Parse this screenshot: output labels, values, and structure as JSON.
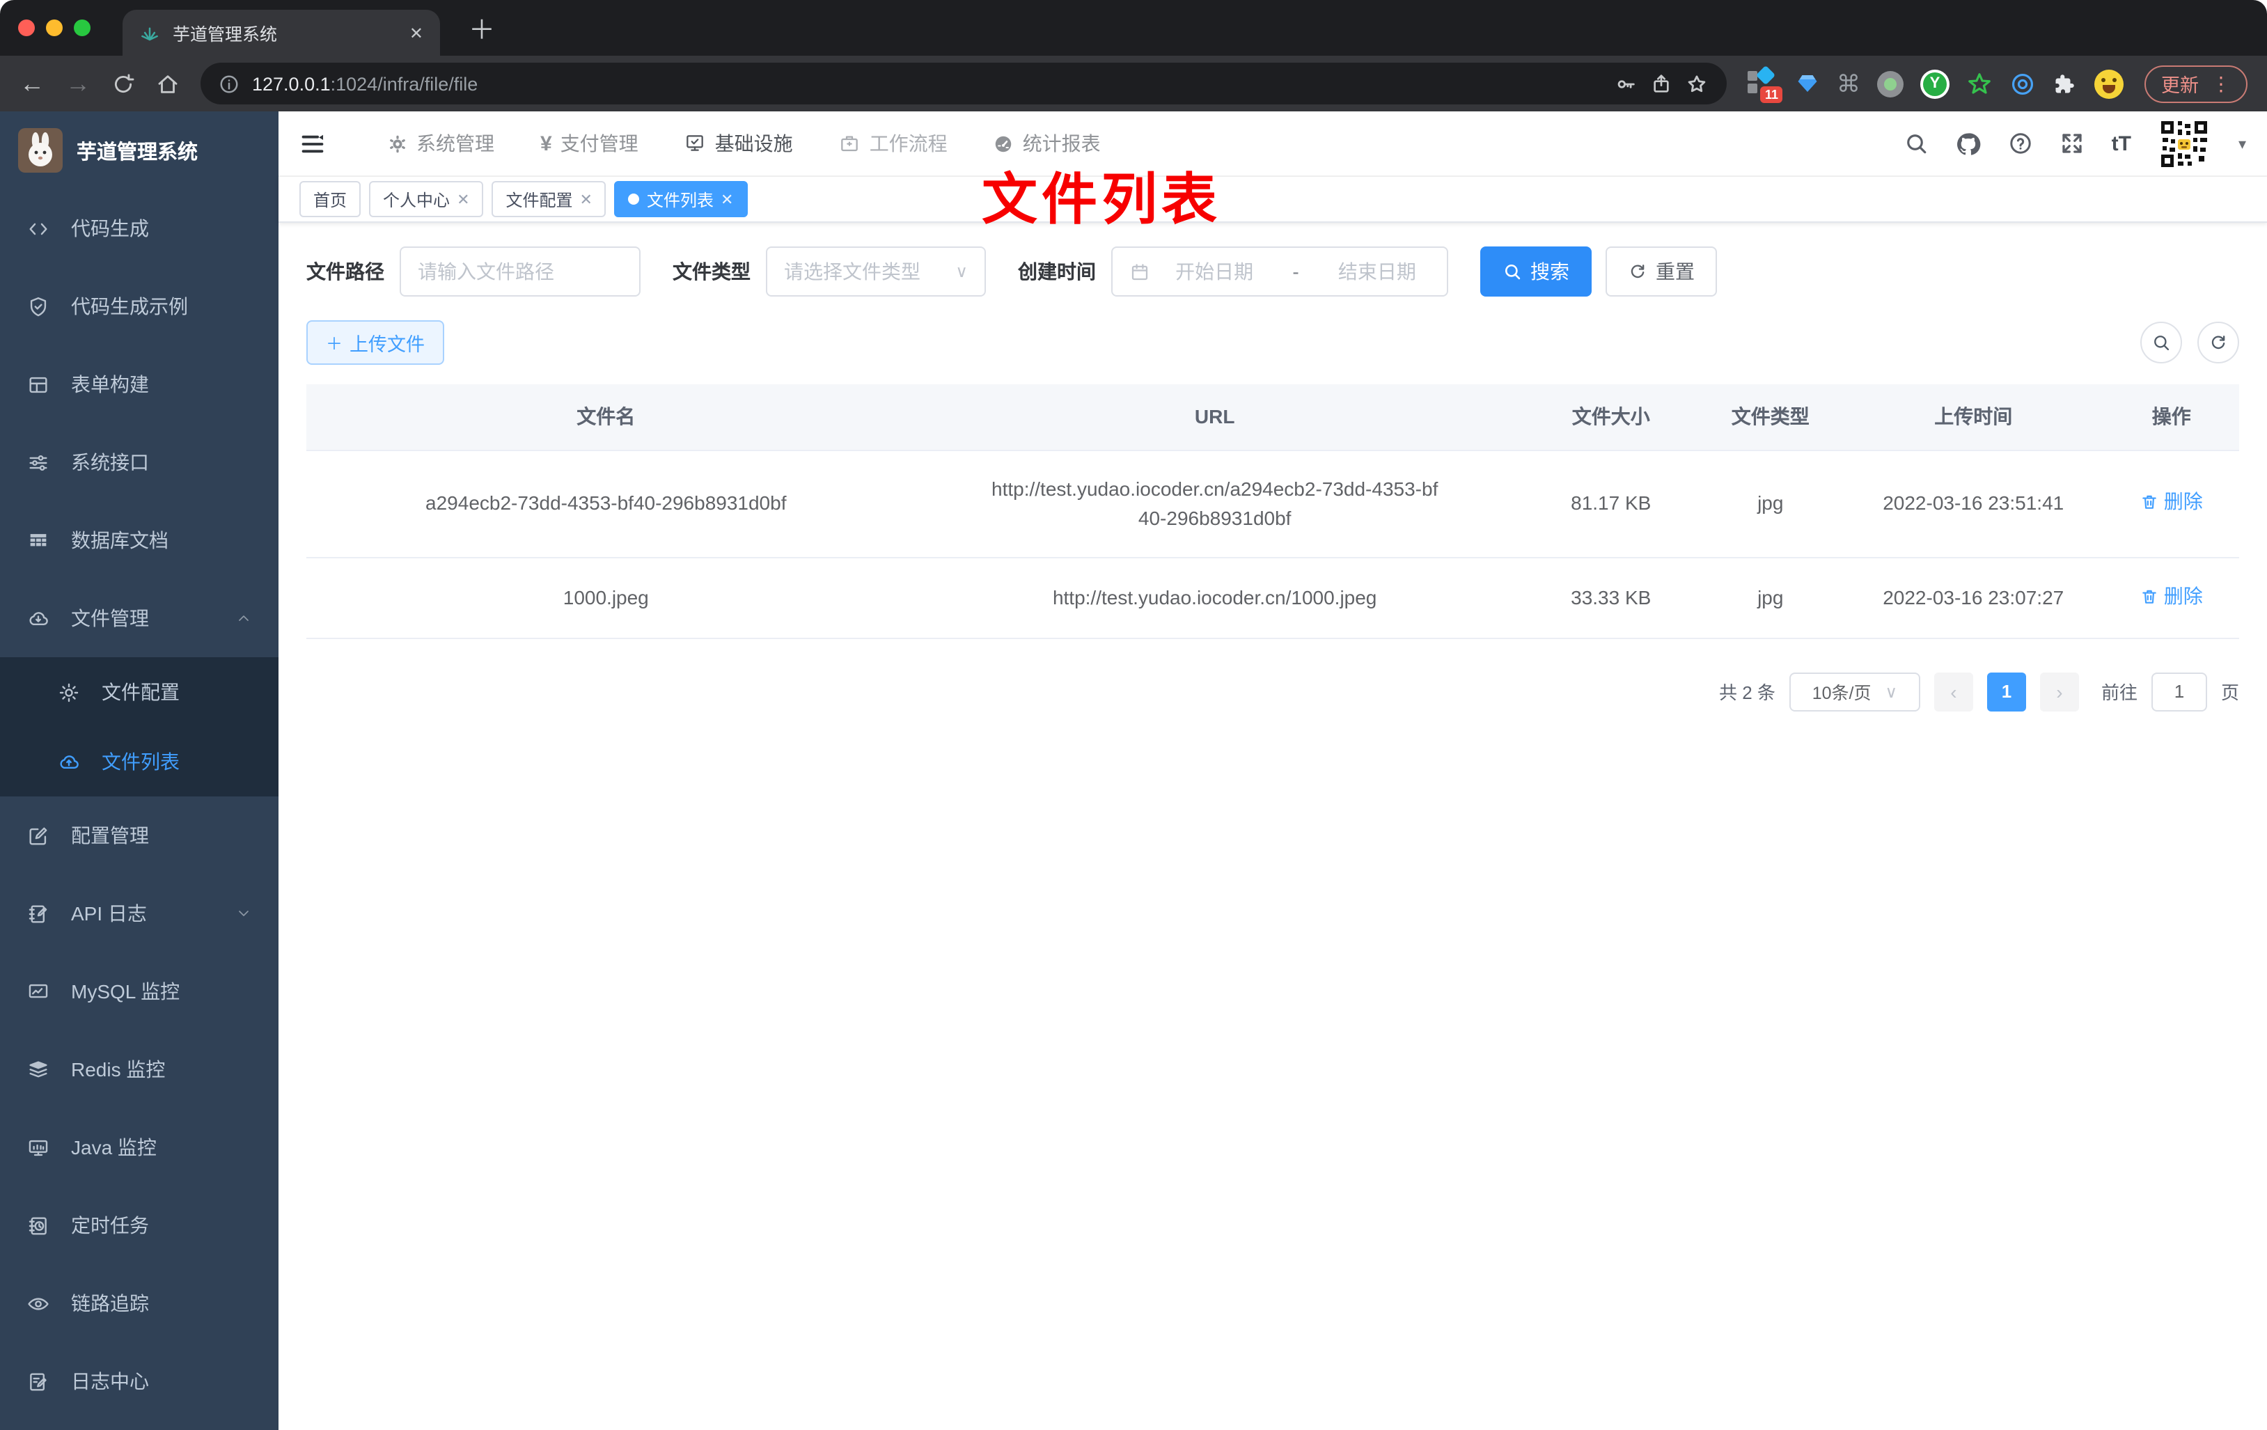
{
  "browser": {
    "tab_title": "芋道管理系统",
    "address": {
      "host": "127.0.0.1",
      "rest": ":1024/infra/file/file"
    },
    "extensions": {
      "badge_count": "11",
      "y_letter": "Y"
    },
    "update_button": "更新"
  },
  "glyphs": {
    "close": "✕",
    "plus": "＋",
    "back": "←",
    "forward": "→",
    "dots": "⋮",
    "command": "⌘",
    "caret_down": "▾",
    "yen": "¥",
    "dash": "-",
    "chevron_down": "∨",
    "prev": "‹",
    "next": "›",
    "font_size": "tT",
    "plus_small": "＋"
  },
  "sidebar": {
    "title": "芋道管理系统",
    "items": [
      {
        "label": "代码生成"
      },
      {
        "label": "代码生成示例"
      },
      {
        "label": "表单构建"
      },
      {
        "label": "系统接口"
      },
      {
        "label": "数据库文档"
      },
      {
        "label": "文件管理"
      },
      {
        "label": "文件配置"
      },
      {
        "label": "文件列表"
      },
      {
        "label": "配置管理"
      },
      {
        "label": "API 日志"
      },
      {
        "label": "MySQL 监控"
      },
      {
        "label": "Redis 监控"
      },
      {
        "label": "Java 监控"
      },
      {
        "label": "定时任务"
      },
      {
        "label": "链路追踪"
      },
      {
        "label": "日志中心"
      }
    ]
  },
  "topnav": {
    "items": [
      {
        "label": "系统管理"
      },
      {
        "label": "支付管理"
      },
      {
        "label": "基础设施"
      },
      {
        "label": "工作流程"
      },
      {
        "label": "统计报表"
      }
    ]
  },
  "tags": [
    {
      "label": "首页"
    },
    {
      "label": "个人中心"
    },
    {
      "label": "文件配置"
    },
    {
      "label": "文件列表"
    }
  ],
  "annotation": "文件列表",
  "filters": {
    "path_label": "文件路径",
    "path_placeholder": "请输入文件路径",
    "type_label": "文件类型",
    "type_placeholder": "请选择文件类型",
    "date_label": "创建时间",
    "date_start": "开始日期",
    "date_sep": "-",
    "date_end": "结束日期",
    "search": "搜索",
    "reset": "重置"
  },
  "toolbar": {
    "upload": "上传文件"
  },
  "table": {
    "columns": [
      "文件名",
      "URL",
      "文件大小",
      "文件类型",
      "上传时间",
      "操作"
    ],
    "rows": [
      {
        "name": "a294ecb2-73dd-4353-bf40-296b8931d0bf",
        "url": "http://test.yudao.iocoder.cn/a294ecb2-73dd-4353-bf40-296b8931d0bf",
        "size": "81.17 KB",
        "type": "jpg",
        "time": "2022-03-16 23:51:41",
        "action": "删除"
      },
      {
        "name": "1000.jpeg",
        "url": "http://test.yudao.iocoder.cn/1000.jpeg",
        "size": "33.33 KB",
        "type": "jpg",
        "time": "2022-03-16 23:07:27",
        "action": "删除"
      }
    ]
  },
  "pagination": {
    "total": "共 2 条",
    "page_size": "10条/页",
    "page": "1",
    "goto_label": "前往",
    "goto_value": "1",
    "goto_suffix": "页"
  },
  "colors": {
    "accent": "#409eff",
    "annotation_red": "#f70000",
    "sidebar_bg": "#304156",
    "submenu_bg": "#1f2d3d"
  }
}
